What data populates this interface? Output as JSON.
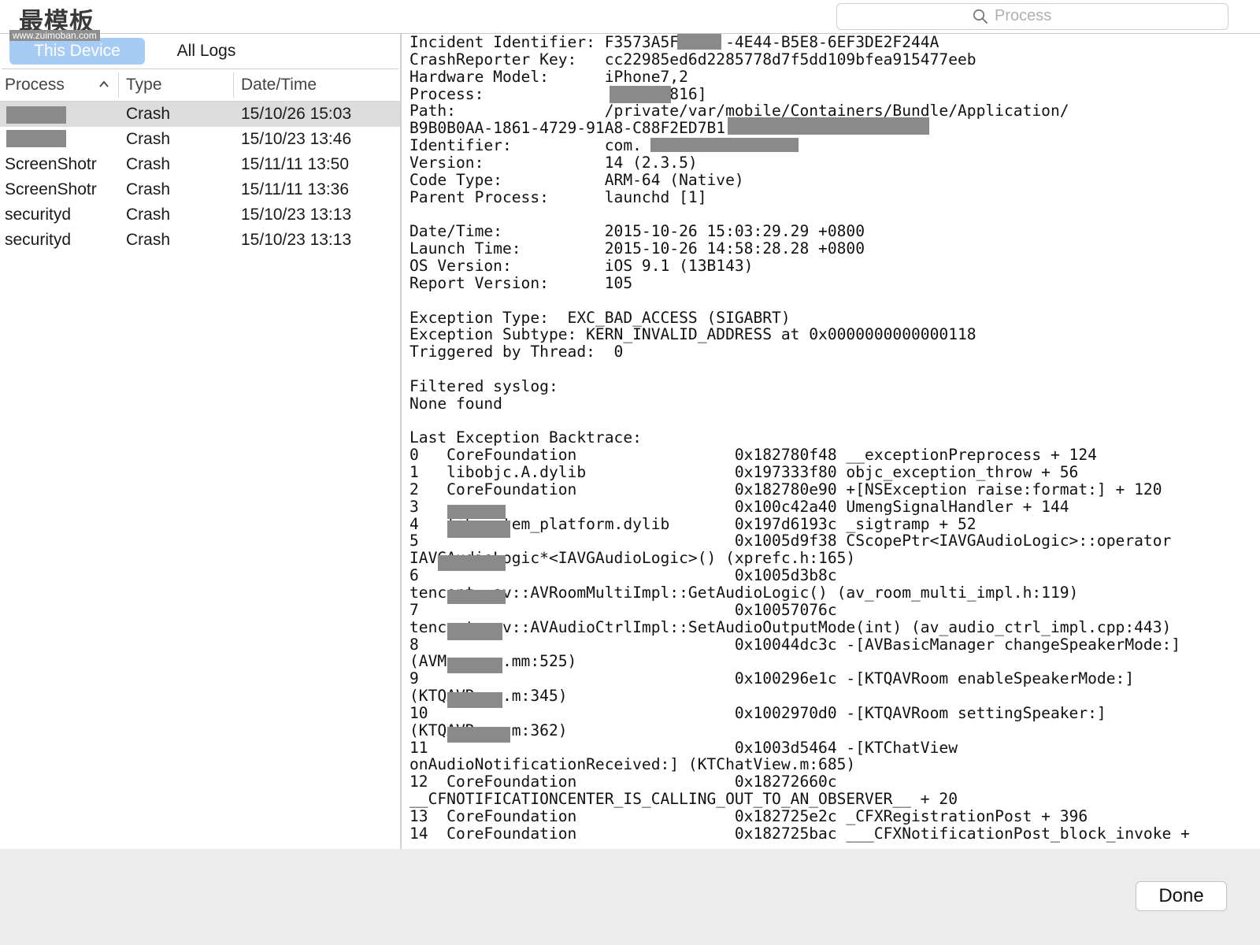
{
  "watermark": {
    "text": "最模板",
    "url": "www.zuimoban.com"
  },
  "search": {
    "placeholder": "Process",
    "value": ""
  },
  "segments": {
    "this_device": "This Device",
    "all_logs": "All Logs",
    "selected": "This Device"
  },
  "columns": {
    "process": "Process",
    "type": "Type",
    "datetime": "Date/Time",
    "sort": "ascending"
  },
  "rows": [
    {
      "process": "",
      "type": "Crash",
      "datetime": "15/10/26 15:03",
      "selected": true
    },
    {
      "process": "",
      "type": "Crash",
      "datetime": "15/10/23 13:46",
      "selected": false
    },
    {
      "process": "ScreenShotr",
      "type": "Crash",
      "datetime": "15/11/11 13:50",
      "selected": false
    },
    {
      "process": "ScreenShotr",
      "type": "Crash",
      "datetime": "15/11/11 13:36",
      "selected": false
    },
    {
      "process": "securityd",
      "type": "Crash",
      "datetime": "15/10/23 13:13",
      "selected": false
    },
    {
      "process": "securityd",
      "type": "Crash",
      "datetime": "15/10/23 13:13",
      "selected": false
    }
  ],
  "log_lines": [
    "Incident Identifier: F3573A5F-    -4E44-B5E8-6EF3DE2F244A",
    "CrashReporter Key:   cc22985ed6d2285778d7f5dd109bfea915477eeb",
    "Hardware Model:      iPhone7,2",
    "Process:                  [1816]",
    "Path:                /private/var/mobile/Containers/Bundle/Application/",
    "B9B0B0AA-1861-4729-91A8-C88F2ED7B1",
    "Identifier:          com.",
    "Version:             14 (2.3.5)",
    "Code Type:           ARM-64 (Native)",
    "Parent Process:      launchd [1]",
    "",
    "Date/Time:           2015-10-26 15:03:29.29 +0800",
    "Launch Time:         2015-10-26 14:58:28.28 +0800",
    "OS Version:          iOS 9.1 (13B143)",
    "Report Version:      105",
    "",
    "Exception Type:  EXC_BAD_ACCESS (SIGABRT)",
    "Exception Subtype: KERN_INVALID_ADDRESS at 0x0000000000000118",
    "Triggered by Thread:  0",
    "",
    "Filtered syslog:",
    "None found",
    "",
    "Last Exception Backtrace:",
    "0   CoreFoundation                 0x182780f48 __exceptionPreprocess + 124",
    "1   libobjc.A.dylib                0x197333f80 objc_exception_throw + 56",
    "2   CoreFoundation                 0x182780e90 +[NSException raise:format:] + 120",
    "3                                  0x100c42a40 UmengSignalHandler + 144",
    "4   libsystem_platform.dylib       0x197d6193c _sigtramp + 52",
    "5                                  0x1005d9f38 CScopePtr<IAVGAudioLogic>::operator",
    "IAVGAudioLogic*<IAVGAudioLogic>() (xprefc.h:165)",
    "6                                  0x1005d3b8c",
    "tencent::av::AVRoomMultiImpl::GetAudioLogic() (av_room_multi_impl.h:119)",
    "7                                  0x10057076c",
    "tencent::av::AVAudioCtrlImpl::SetAudioOutputMode(int) (av_audio_ctrl_impl.cpp:443)",
    "8                                  0x10044dc3c -[AVBasicManager changeSpeakerMode:]",
    "(AVManager.mm:525)",
    "9                                  0x100296e1c -[KTQAVRoom enableSpeakerMode:]",
    "(KTQAVRoom.m:345)",
    "10                                 0x1002970d0 -[KTQAVRoom settingSpeaker:]",
    "(KTQAVRoom.m:362)",
    "11                                 0x1003d5464 -[KTChatView",
    "onAudioNotificationReceived:] (KTChatView.m:685)",
    "12  CoreFoundation                 0x18272660c",
    "__CFNOTIFICATIONCENTER_IS_CALLING_OUT_TO_AN_OBSERVER__ + 20",
    "13  CoreFoundation                 0x182725e2c _CFXRegistrationPost + 396",
    "14  CoreFoundation                 0x182725bac ___CFXNotificationPost_block_invoke +"
  ],
  "done_label": "Done",
  "colors": {
    "selected_segment": "#a6cbf5",
    "selected_row": "#dcdcdc",
    "redaction": "#8a8a8a",
    "bottom_bar": "#ececec"
  }
}
